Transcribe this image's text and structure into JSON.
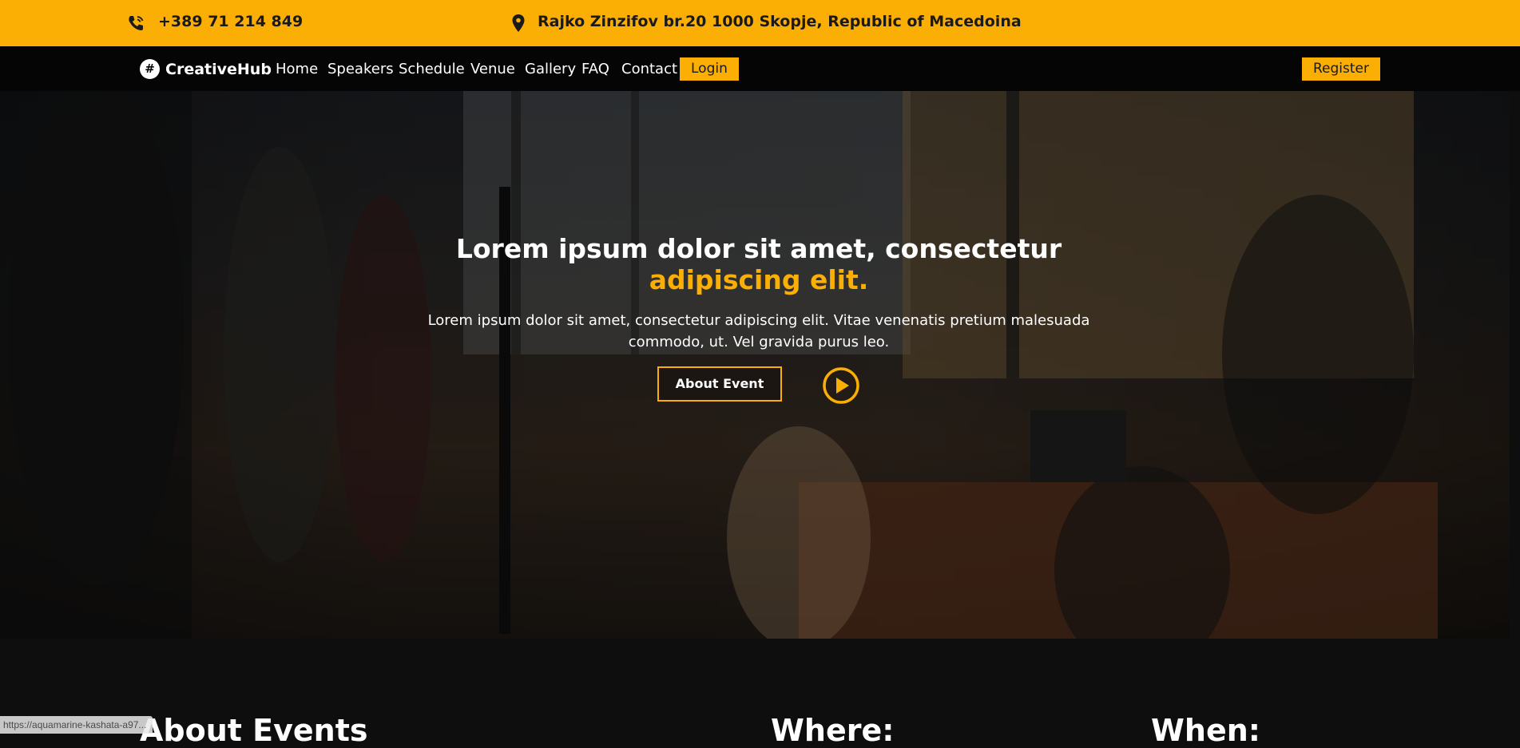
{
  "topbar": {
    "phone": "+389 71 214 849",
    "address": "Rajko Zinzifov br.20 1000 Skopje, Republic of Macedoina",
    "phone_icon": "phone-icon",
    "location_icon": "map-pin-icon"
  },
  "nav": {
    "logo_mark": "#",
    "logo_text": "CreativeHub",
    "links": [
      "Home",
      "Speakers",
      "Schedule",
      "Venue",
      "Gallery",
      "FAQ",
      "Contact"
    ],
    "login_label": "Login",
    "register_label": "Register"
  },
  "hero": {
    "title_main": "Lorem ipsum dolor sit amet, consectetur ",
    "title_accent": "adipiscing elit.",
    "subtitle": "Lorem ipsum dolor sit amet, consectetur adipiscing elit. Vitae venenatis pretium malesuada commodo, ut. Vel gravida purus leo.",
    "about_label": "About Event",
    "play_icon": "play-circle-icon"
  },
  "sections": {
    "about_heading": "About Events",
    "where_heading": "Where:",
    "when_heading": "When:"
  },
  "status_bar": {
    "url": "https://aquamarine-kashata-a97..."
  },
  "colors": {
    "accent": "#fbae03",
    "nav_bg": "#050505",
    "page_bg": "#0e0e0e"
  }
}
